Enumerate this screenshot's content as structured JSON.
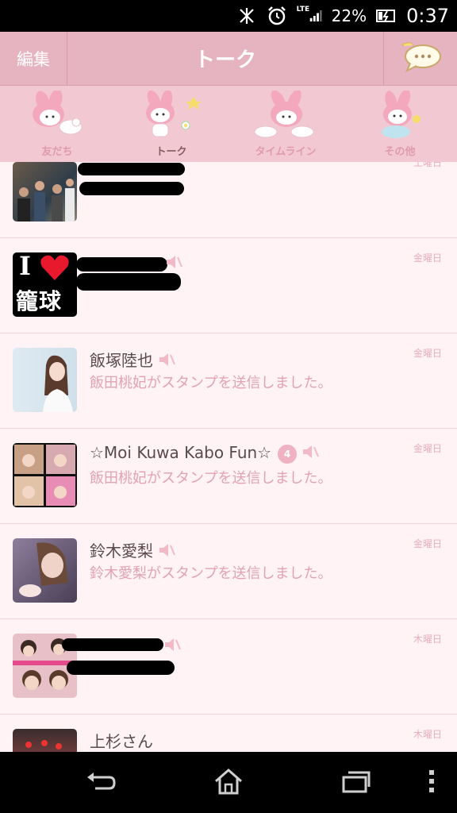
{
  "status": {
    "battery_pct": "22%",
    "time": "0:37",
    "network": "LTE"
  },
  "header": {
    "edit": "編集",
    "title": "トーク"
  },
  "tabs": [
    {
      "label": "友だち"
    },
    {
      "label": "トーク"
    },
    {
      "label": "タイムライン"
    },
    {
      "label": "その他"
    }
  ],
  "chats": [
    {
      "name": "",
      "message": "",
      "date": "土曜日"
    },
    {
      "name": "",
      "message": "",
      "date": "金曜日"
    },
    {
      "name": "飯塚陸也",
      "message": "飯田桃妃がスタンプを送信しました。",
      "date": "金曜日"
    },
    {
      "name": "☆Moi Kuwa Kabo Fun☆",
      "message": "飯田桃妃がスタンプを送信しました。",
      "date": "金曜日",
      "badge": "4"
    },
    {
      "name": "鈴木愛梨",
      "message": "鈴木愛梨がスタンプを送信しました。",
      "date": "金曜日"
    },
    {
      "name": "",
      "message": "",
      "date": "木曜日"
    },
    {
      "name": "上杉さん",
      "message": "",
      "date": "木曜日"
    }
  ],
  "avatar_text": {
    "i": "I",
    "kago": "籠球"
  },
  "colors": {
    "header": "#e6b4c0",
    "tabs": "#f2c9d3",
    "list_bg": "#fff3f5",
    "message": "#e2a2b2"
  }
}
